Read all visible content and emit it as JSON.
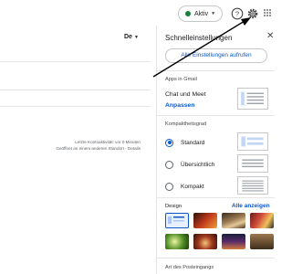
{
  "header": {
    "status_label": "Aktiv",
    "status_color": "#188038",
    "icons": [
      "help-icon",
      "gear-icon",
      "apps-grid-icon"
    ]
  },
  "mail": {
    "language_label": "De",
    "activity_line1": "Letzte Kontoaktivität: vor 0 Minuten",
    "activity_line2": "Geöffnet an einem anderen Standort · Details"
  },
  "quick_settings": {
    "title": "Schnelleinstellungen",
    "close_icon": "close-icon",
    "all_settings_button": "Alle Einstellungen aufrufen",
    "apps_section": "Apps in Gmail",
    "chat_meet_label": "Chat und Meet",
    "customize_link": "Anpassen",
    "density_section": "Kompaktheitsgrad",
    "density_options": [
      {
        "label": "Standard",
        "selected": true
      },
      {
        "label": "Übersichtlich",
        "selected": false
      },
      {
        "label": "Kompakt",
        "selected": false
      }
    ],
    "design_section": "Design",
    "show_all_link": "Alle anzeigen",
    "inbox_type_section": "Art des Posteingangs"
  },
  "colors": {
    "accent": "#0b57d0",
    "status_green": "#188038",
    "arrow": "#000000"
  }
}
